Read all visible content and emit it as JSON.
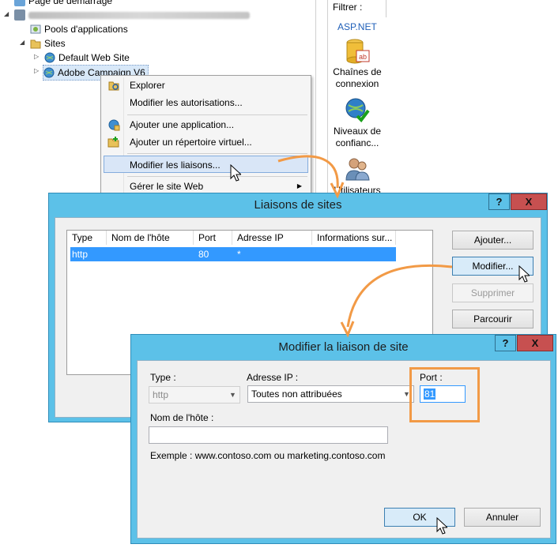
{
  "tree": {
    "start_page": "Page de démarrage",
    "app_pools": "Pools d'applications",
    "sites": "Sites",
    "default_site": "Default Web Site",
    "adobe_site": "Adobe Campaign V6"
  },
  "features": {
    "filter_label": "Filtrer :",
    "aspnet_header": "ASP.NET",
    "items": [
      {
        "label": "Chaînes de connexion",
        "icon": "database-icon"
      },
      {
        "label": "Niveaux de confianc...",
        "icon": "globe-check-icon"
      },
      {
        "label": "Utilisateurs",
        "icon": "users-icon"
      }
    ]
  },
  "context_menu": {
    "items": [
      {
        "label": "Explorer",
        "icon": "explore-icon"
      },
      {
        "label": "Modifier les autorisations...",
        "icon": ""
      },
      {
        "label": "Ajouter une application...",
        "icon": "add-app-icon"
      },
      {
        "label": "Ajouter un répertoire virtuel...",
        "icon": "add-vdir-icon"
      },
      {
        "label": "Modifier les liaisons...",
        "icon": ""
      },
      {
        "label": "Gérer le site Web",
        "icon": "",
        "submenu": true
      }
    ],
    "submenu_glyph": "▶"
  },
  "bindings_dialog": {
    "title": "Liaisons de sites",
    "help": "?",
    "close": "X",
    "columns": [
      "Type",
      "Nom de l'hôte",
      "Port",
      "Adresse IP",
      "Informations sur..."
    ],
    "rows": [
      {
        "type": "http",
        "host": "",
        "port": "80",
        "ip": "*",
        "info": ""
      }
    ],
    "buttons": {
      "add": "Ajouter...",
      "edit": "Modifier...",
      "remove": "Supprimer",
      "browse": "Parcourir"
    }
  },
  "edit_dialog": {
    "title": "Modifier la liaison de site",
    "help": "?",
    "close": "X",
    "type_label": "Type :",
    "type_value": "http",
    "ip_label": "Adresse IP :",
    "ip_value": "Toutes non attribuées",
    "port_label": "Port :",
    "port_value": "81",
    "host_label": "Nom de l'hôte :",
    "host_value": "",
    "example": "Exemple : www.contoso.com ou marketing.contoso.com",
    "ok": "OK",
    "cancel": "Annuler"
  },
  "colors": {
    "dialog_frame": "#5cc1e8",
    "selection": "#3399ff",
    "highlight_box": "#f29a46",
    "close_button": "#c75050"
  }
}
